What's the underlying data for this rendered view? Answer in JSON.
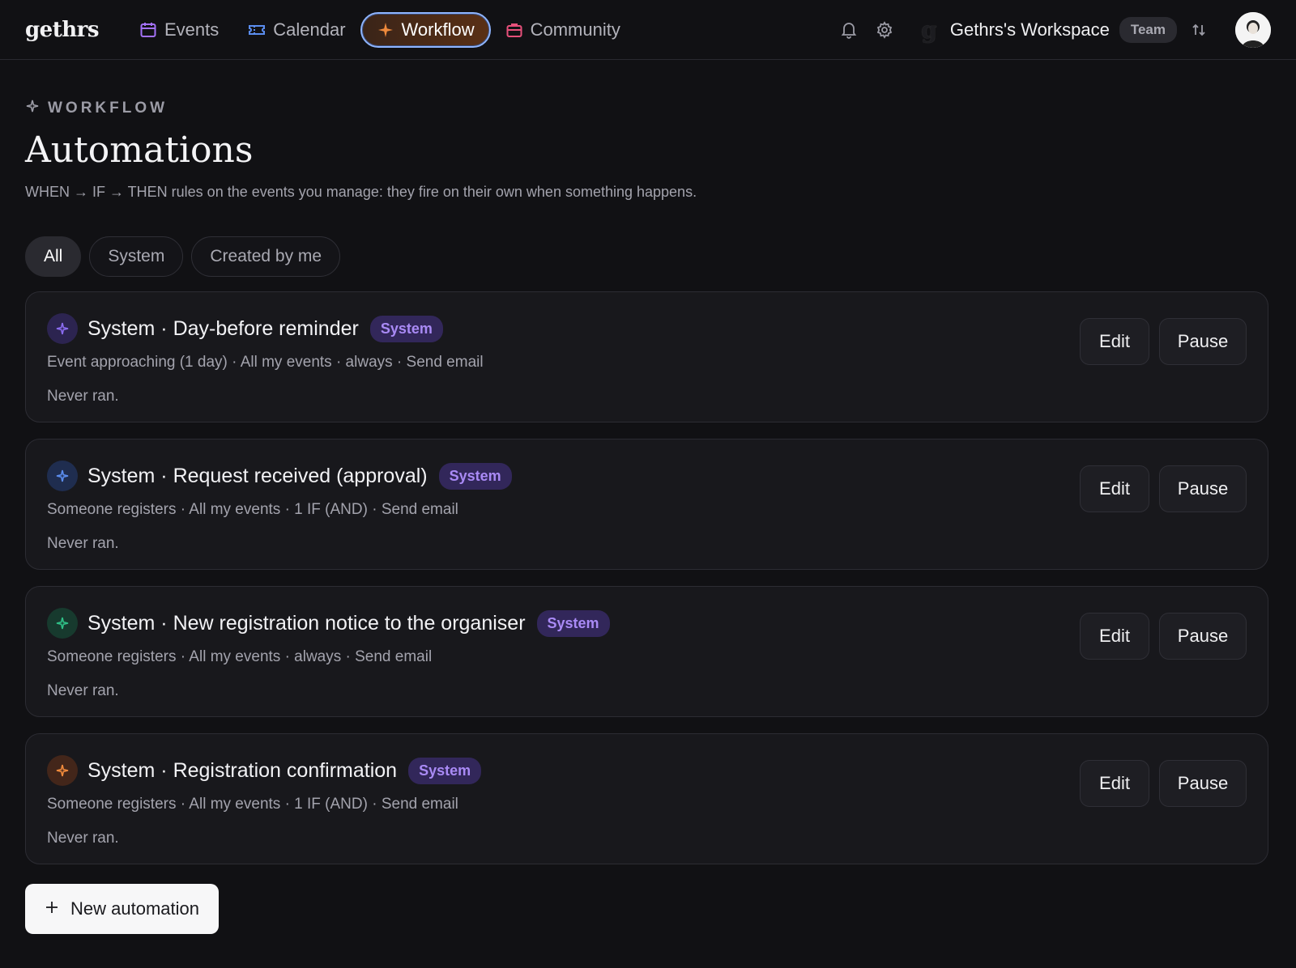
{
  "app": {
    "logo": "gethrs"
  },
  "nav": {
    "items": [
      {
        "label": "Events",
        "icon": "calendar-icon",
        "color": "#a371f7"
      },
      {
        "label": "Calendar",
        "icon": "ticket-icon",
        "color": "#5b8def"
      },
      {
        "label": "Workflow",
        "icon": "sparkle-icon",
        "color": "#f08a3c",
        "active": true
      },
      {
        "label": "Community",
        "icon": "briefcase-icon",
        "color": "#e6507a"
      }
    ]
  },
  "topright": {
    "workspace_name": "Gethrs's Workspace",
    "workspace_badge": "Team",
    "workspace_mark": "g"
  },
  "header": {
    "eyebrow": "WORKFLOW",
    "title": "Automations",
    "subtitle": "WHEN → IF → THEN rules on the events you manage: they fire on their own when something happens."
  },
  "filters": [
    {
      "label": "All",
      "active": true
    },
    {
      "label": "System",
      "active": false
    },
    {
      "label": "Created by me",
      "active": false
    }
  ],
  "automations": [
    {
      "title": "System · Day-before reminder",
      "tag": "System",
      "meta": "Event approaching (1 day) · All my events · always · Send email",
      "status": "Never ran.",
      "icon_color": "#8b6cf0",
      "icon_bg": "#2c2450",
      "edit_label": "Edit",
      "pause_label": "Pause"
    },
    {
      "title": "System · Request received (approval)",
      "tag": "System",
      "meta": "Someone registers · All my events · 1 IF (AND) · Send email",
      "status": "Never ran.",
      "icon_color": "#5b8def",
      "icon_bg": "#1f2d4f",
      "edit_label": "Edit",
      "pause_label": "Pause"
    },
    {
      "title": "System · New registration notice to the organiser",
      "tag": "System",
      "meta": "Someone registers · All my events · always · Send email",
      "status": "Never ran.",
      "icon_color": "#2fbf86",
      "icon_bg": "#173a2e",
      "edit_label": "Edit",
      "pause_label": "Pause"
    },
    {
      "title": "System · Registration confirmation",
      "tag": "System",
      "meta": "Someone registers · All my events · 1 IF (AND) · Send email",
      "status": "Never ran.",
      "icon_color": "#f08a3c",
      "icon_bg": "#43261a",
      "edit_label": "Edit",
      "pause_label": "Pause"
    }
  ],
  "new_button": {
    "label": "New automation"
  }
}
